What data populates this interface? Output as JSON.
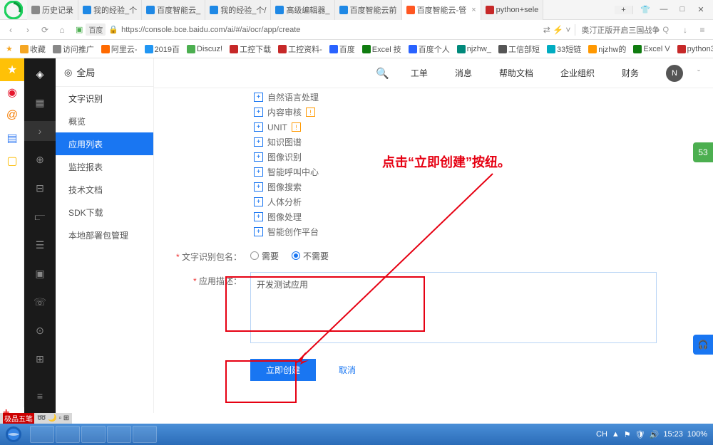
{
  "tabs": [
    {
      "label": "历史记录",
      "icon": "#888"
    },
    {
      "label": "我的经验_个",
      "icon": "#1e88e5"
    },
    {
      "label": "百度智能云_",
      "icon": "#1e88e5"
    },
    {
      "label": "我的经验_个/",
      "icon": "#1e88e5"
    },
    {
      "label": "高级编辑器_",
      "icon": "#1e88e5"
    },
    {
      "label": "百度智能云前",
      "icon": "#1e88e5"
    },
    {
      "label": "百度智能云-管",
      "icon": "#ff5722",
      "active": true
    },
    {
      "label": "python+sele",
      "icon": "#c62828"
    }
  ],
  "url": {
    "badge": "百度",
    "text": "https://console.bce.baidu.com/ai/#/ai/ocr/app/create"
  },
  "searchHint": "奥汀正版开启三国战争",
  "bookmarks": [
    {
      "label": "收藏",
      "color": "#f5a623"
    },
    {
      "label": "访问推广",
      "color": "#888"
    },
    {
      "label": "阿里云-",
      "color": "#ff6a00"
    },
    {
      "label": "2019百",
      "color": "#2196f3"
    },
    {
      "label": "Discuz!",
      "color": "#4caf50"
    },
    {
      "label": "工控下载",
      "color": "#c62828"
    },
    {
      "label": "工控资料-",
      "color": "#c62828"
    },
    {
      "label": "百度",
      "color": "#2962ff"
    },
    {
      "label": "Excel 技",
      "color": "#107c10"
    },
    {
      "label": "百度个人",
      "color": "#2962ff"
    },
    {
      "label": "njzhw_",
      "color": "#00897b"
    },
    {
      "label": "工信部短",
      "color": "#555"
    },
    {
      "label": "33短链",
      "color": "#00acc1"
    },
    {
      "label": "njzhw的",
      "color": "#ff9800"
    },
    {
      "label": "Excel V",
      "color": "#107c10"
    },
    {
      "label": "python3",
      "color": "#c62828"
    }
  ],
  "sidebarHead": "全局",
  "sidebarGroup": "文字识别",
  "sidebar": [
    {
      "label": "概览"
    },
    {
      "label": "应用列表",
      "active": true
    },
    {
      "label": "监控报表"
    },
    {
      "label": "技术文档"
    },
    {
      "label": "SDK下载"
    },
    {
      "label": "本地部署包管理"
    }
  ],
  "topnav": [
    "工单",
    "消息",
    "帮助文档",
    "企业组织",
    "财务"
  ],
  "avatar": "N",
  "checkItems": [
    {
      "label": "自然语言处理"
    },
    {
      "label": "内容审核",
      "badge": "!"
    },
    {
      "label": "UNIT",
      "badge": "!"
    },
    {
      "label": "知识图谱"
    },
    {
      "label": "图像识别"
    },
    {
      "label": "智能呼叫中心"
    },
    {
      "label": "图像搜索"
    },
    {
      "label": "人体分析"
    },
    {
      "label": "图像处理"
    },
    {
      "label": "智能创作平台"
    }
  ],
  "form": {
    "pkgLabel": "文字识别包名：",
    "radioNeed": "需要",
    "radioNoNeed": "不需要",
    "descLabel": "应用描述：",
    "descValue": "开发测试应用",
    "submit": "立即创建",
    "cancel": "取消"
  },
  "annotation": "点击“立即创建”按纽。",
  "ime": "极品五笔",
  "clock": "15:23",
  "date": "100%"
}
